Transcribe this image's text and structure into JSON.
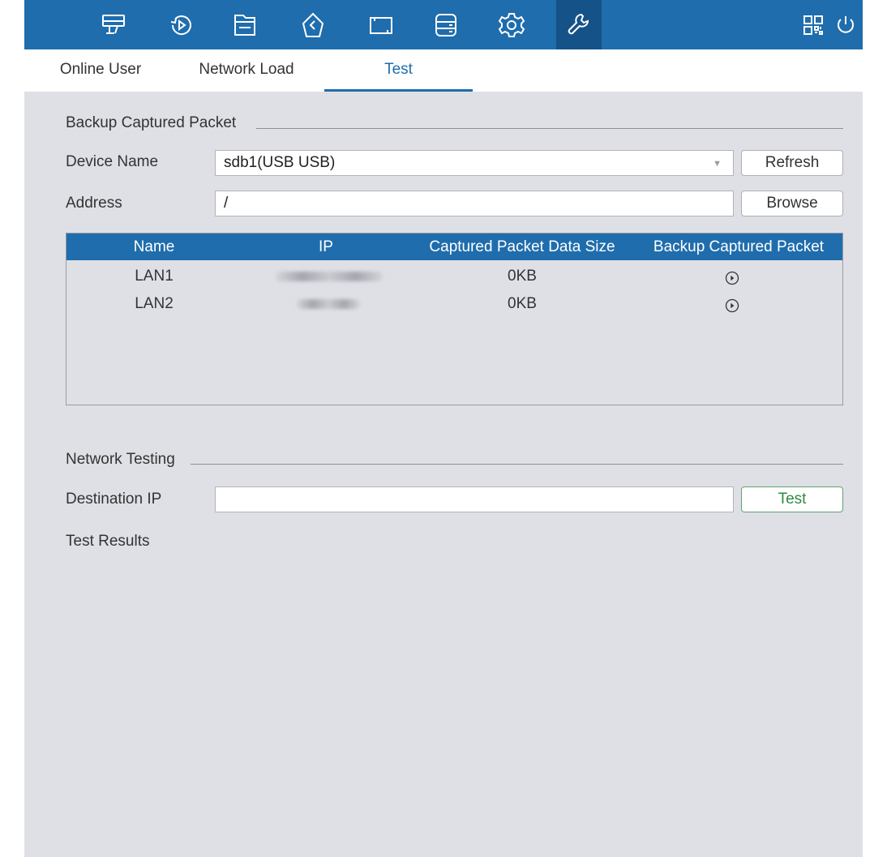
{
  "topbar": {
    "icons": [
      "live-view-icon",
      "playback-icon",
      "file-icon",
      "smart-icon",
      "channel-icon",
      "storage-icon",
      "settings-icon",
      "maintenance-icon",
      "qrcode-icon",
      "power-icon"
    ],
    "accent": "#1f6dad",
    "active_icon": "maintenance-icon"
  },
  "tabs": [
    {
      "label": "Online User"
    },
    {
      "label": "Network Load"
    },
    {
      "label": "Test",
      "active": true
    }
  ],
  "backup": {
    "title": "Backup Captured Packet",
    "device_label": "Device Name",
    "device_value": "sdb1(USB USB)",
    "refresh_label": "Refresh",
    "address_label": "Address",
    "address_value": "/",
    "browse_label": "Browse",
    "table": {
      "headers": [
        "Name",
        "IP",
        "Captured Packet Data Size",
        "Backup Captured Packet"
      ],
      "rows": [
        {
          "name": "LAN1",
          "size": "0KB"
        },
        {
          "name": "LAN2",
          "size": "0KB"
        }
      ]
    }
  },
  "network_testing": {
    "title": "Network Testing",
    "dest_label": "Destination IP",
    "dest_value": "",
    "test_label": "Test",
    "results_label": "Test Results"
  }
}
